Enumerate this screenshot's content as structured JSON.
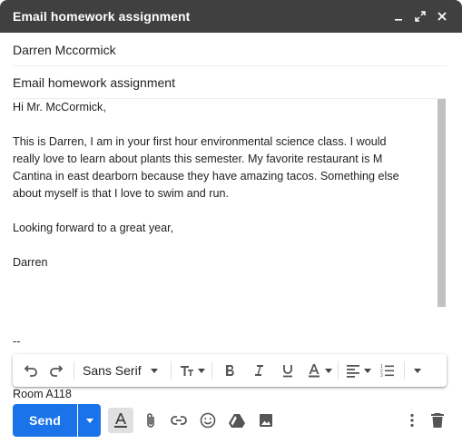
{
  "window": {
    "title": "Email homework assignment",
    "controls": [
      {
        "icon": "minimize-icon"
      },
      {
        "icon": "fullscreen-icon"
      },
      {
        "icon": "close-icon"
      }
    ]
  },
  "compose": {
    "recipients": "Darren Mccormick",
    "subject": "Email homework assignment",
    "body": {
      "greeting": "Hi Mr. McCormick,",
      "paragraph_lines": [
        "This is Darren, I am in your first hour environmental science class. I would",
        "really love to learn about plants this semester. My favorite restaurant is M",
        "Cantina in east dearborn because they have amazing tacos. Something else",
        "about myself is that I love to swim and run."
      ],
      "closing": "Looking forward to a great year,",
      "name": "Darren",
      "signature_dash": "--",
      "signature_room": "Room A118"
    }
  },
  "format_toolbar": {
    "font": "Sans Serif",
    "icons": [
      "undo-icon",
      "redo-icon",
      "text-size-icon",
      "bold-icon",
      "italic-icon",
      "underline-icon",
      "text-color-icon",
      "align-icon",
      "numbered-list-icon",
      "more-formatting-icon"
    ]
  },
  "bottom_bar": {
    "send_label": "Send",
    "icons": [
      "formatting-options-icon",
      "attach-icon",
      "link-icon",
      "emoji-icon",
      "drive-icon",
      "photo-icon",
      "more-options-icon",
      "discard-icon"
    ],
    "colors": {
      "send": "#1a73e8",
      "titlebar": "#404040"
    }
  }
}
